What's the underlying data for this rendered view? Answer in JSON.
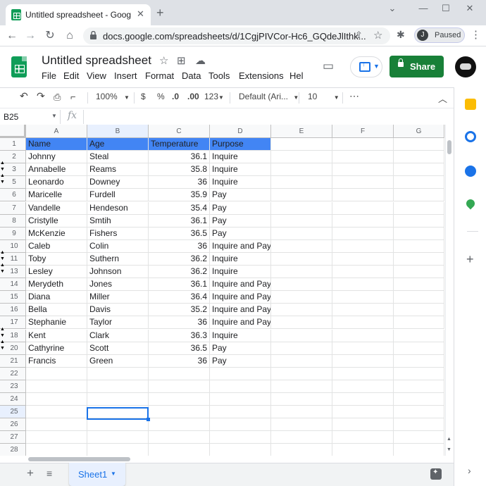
{
  "browser": {
    "tab_title": "Untitled spreadsheet - Google Sh",
    "tab_close": "✕",
    "new_tab": "+",
    "url": "docs.google.com/spreadsheets/d/1CgjPIVCor-Hc6_GQdeJlIthk...",
    "profile_initial": "J",
    "profile_status": "Paused"
  },
  "app": {
    "title": "Untitled spreadsheet",
    "menu": [
      "File",
      "Edit",
      "View",
      "Insert",
      "Format",
      "Data",
      "Tools",
      "Extensions",
      "Hel"
    ],
    "share_label": "Share",
    "accent": "#188038"
  },
  "toolbar": {
    "zoom": "100%",
    "currency": "$",
    "percent": "%",
    "dec_less": ".0",
    "dec_more": ".00",
    "number_format": "123",
    "font": "Default (Ari...",
    "font_size": "10",
    "more": "⋯"
  },
  "formula_bar": {
    "name_box": "B25",
    "fx": "fx",
    "value": ""
  },
  "grid": {
    "columns": [
      "A",
      "B",
      "C",
      "D",
      "E",
      "F",
      "G"
    ],
    "selected_column": "B",
    "selected_row": 25,
    "header_color": "#4285f4",
    "rows": [
      {
        "num": "1",
        "cells": [
          "Name",
          "Age",
          "Temperature",
          "Purpose"
        ]
      },
      {
        "num": "2",
        "cells": [
          "Johnny",
          "Steal",
          "36.1",
          "Inquire"
        ]
      },
      {
        "num": "3",
        "cells": [
          "Annabelle",
          "Reams",
          "35.8",
          "Inquire"
        ]
      },
      {
        "num": "5",
        "cells": [
          "Leonardo",
          "Downey",
          "36",
          "Inquire"
        ]
      },
      {
        "num": "6",
        "cells": [
          "Maricelle",
          "Furdell",
          "35.9",
          "Pay"
        ]
      },
      {
        "num": "7",
        "cells": [
          "Vandelle",
          "Hendeson",
          "35.4",
          "Pay"
        ]
      },
      {
        "num": "8",
        "cells": [
          "Cristylle",
          "Smtih",
          "36.1",
          "Pay"
        ]
      },
      {
        "num": "9",
        "cells": [
          "McKenzie",
          "Fishers",
          "36.5",
          "Pay"
        ]
      },
      {
        "num": "10",
        "cells": [
          "Caleb",
          "Colin",
          "36",
          "Inquire and Pay"
        ]
      },
      {
        "num": "11",
        "cells": [
          "Toby",
          "Suthern",
          "36.2",
          "Inquire"
        ]
      },
      {
        "num": "13",
        "cells": [
          "Lesley",
          "Johnson",
          "36.2",
          "Inquire"
        ]
      },
      {
        "num": "14",
        "cells": [
          "Merydeth",
          "Jones",
          "36.1",
          "Inquire and Pay"
        ]
      },
      {
        "num": "15",
        "cells": [
          "Diana",
          "Miller",
          "36.4",
          "Inquire and Pay"
        ]
      },
      {
        "num": "16",
        "cells": [
          "Bella",
          "Davis",
          "35.2",
          "Inquire and Pay"
        ]
      },
      {
        "num": "17",
        "cells": [
          "Stephanie",
          "Taylor",
          "36",
          "Inquire and Pay"
        ]
      },
      {
        "num": "18",
        "cells": [
          "Kent",
          "Clark",
          "36.3",
          "Inquire"
        ]
      },
      {
        "num": "20",
        "cells": [
          "Cathyrine",
          "Scott",
          "36.5",
          "Pay"
        ]
      },
      {
        "num": "21",
        "cells": [
          "Francis",
          "Green",
          "36",
          "Pay"
        ]
      },
      {
        "num": "22",
        "cells": [
          "",
          "",
          "",
          ""
        ]
      },
      {
        "num": "23",
        "cells": [
          "",
          "",
          "",
          ""
        ]
      },
      {
        "num": "24",
        "cells": [
          "",
          "",
          "",
          ""
        ]
      },
      {
        "num": "25",
        "cells": [
          "",
          "",
          "",
          ""
        ]
      },
      {
        "num": "26",
        "cells": [
          "",
          "",
          "",
          ""
        ]
      },
      {
        "num": "27",
        "cells": [
          "",
          "",
          "",
          ""
        ]
      },
      {
        "num": "28",
        "cells": [
          "",
          "",
          "",
          ""
        ]
      }
    ],
    "hidden_row_markers_before": [
      "3",
      "5",
      "11",
      "13",
      "18",
      "20"
    ]
  },
  "sheets": {
    "tabs": [
      "Sheet1"
    ],
    "add": "+",
    "all": "≡"
  }
}
